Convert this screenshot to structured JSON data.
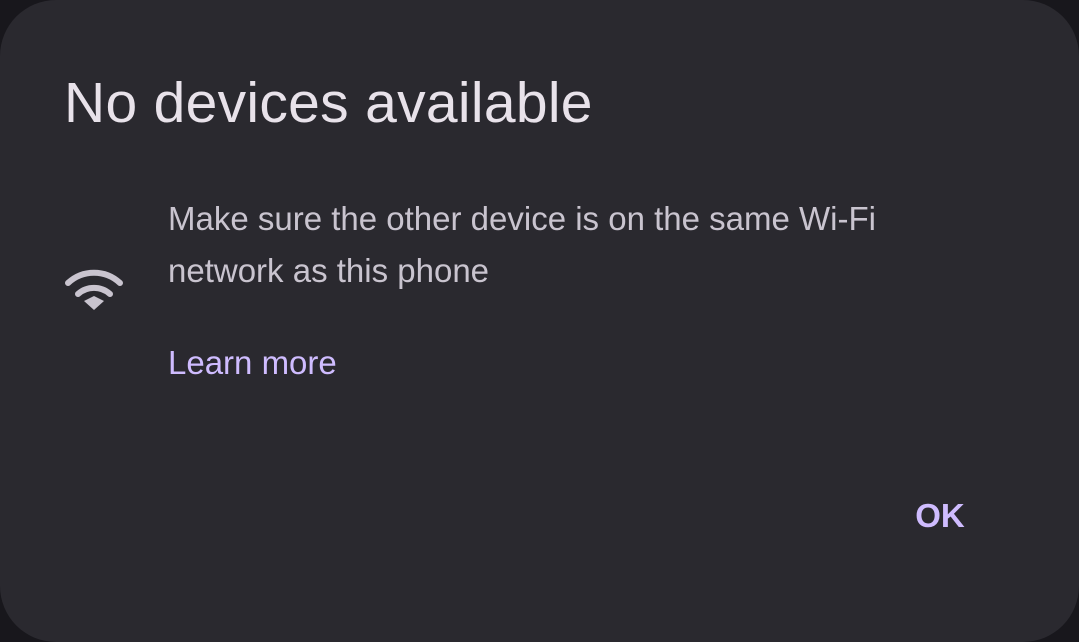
{
  "dialog": {
    "title": "No devices available",
    "message": "Make sure the other device is on the same Wi-Fi network as this phone",
    "link_label": "Learn more",
    "ok_label": "OK",
    "icon": "wifi-icon"
  },
  "colors": {
    "background": "#2a292f",
    "title": "#e8e2ea",
    "body_text": "#c9c4cf",
    "accent": "#cfbcff"
  }
}
